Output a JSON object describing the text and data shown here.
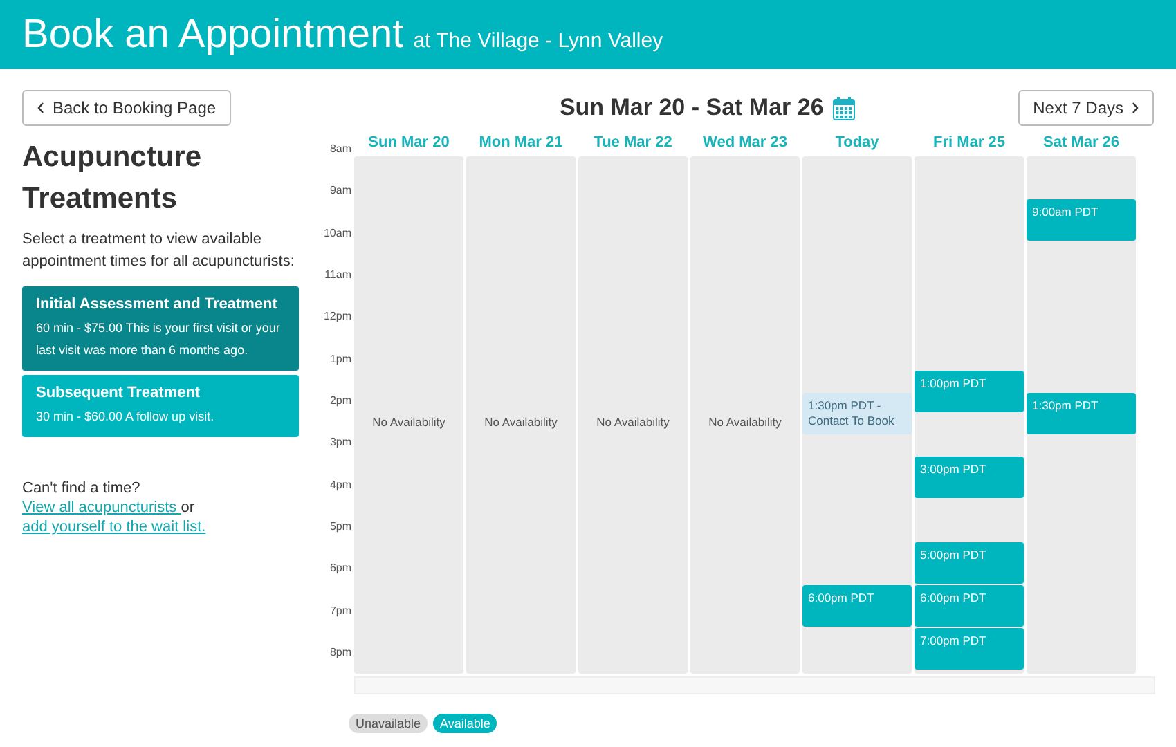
{
  "header": {
    "title": "Book an Appointment",
    "location": "at The Village - Lynn Valley"
  },
  "toolbar": {
    "back_button": "Back to Booking Page",
    "date_range": "Sun Mar 20 - Sat Mar 26",
    "next_button": "Next 7 Days"
  },
  "sidebar": {
    "title": "Acupuncture Treatments",
    "intro": "Select a treatment to view available appointment times for all acupuncturists:",
    "treatments": [
      {
        "name": "Initial Assessment and Treatment",
        "details": "60 min - $75.00 This is your first visit or your last visit was more than 6 months ago.",
        "selected": true
      },
      {
        "name": "Subsequent Treatment",
        "details": "30 min - $60.00 A follow up visit.",
        "selected": false
      }
    ],
    "help_title": "Can't find a time?",
    "help_link_1": "View all acupuncturists ",
    "help_joiner": "or",
    "help_link_2": "add yourself to the wait list."
  },
  "calendar": {
    "hours": [
      "8am",
      "9am",
      "10am",
      "11am",
      "12pm",
      "1pm",
      "2pm",
      "3pm",
      "4pm",
      "5pm",
      "6pm",
      "7pm",
      "8pm"
    ],
    "days": [
      {
        "label": "Sun Mar 20",
        "note": "No Availability"
      },
      {
        "label": "Mon Mar 21",
        "note": "No Availability"
      },
      {
        "label": "Tue Mar 22",
        "note": "No Availability"
      },
      {
        "label": "Wed Mar 23",
        "note": "No Availability"
      },
      {
        "label": "Today",
        "slots": [
          {
            "kind": "contact",
            "text": "1:30pm PDT - Contact To Book"
          },
          {
            "kind": "available",
            "text": "6:00pm PDT"
          }
        ]
      },
      {
        "label": "Fri Mar 25",
        "slots": [
          {
            "kind": "available",
            "text": "1:00pm PDT"
          },
          {
            "kind": "available",
            "text": "3:00pm PDT"
          },
          {
            "kind": "available",
            "text": "5:00pm PDT"
          },
          {
            "kind": "available",
            "text": "6:00pm PDT"
          },
          {
            "kind": "available",
            "text": "7:00pm PDT"
          }
        ]
      },
      {
        "label": "Sat Mar 26",
        "slots": [
          {
            "kind": "available",
            "text": "9:00am PDT"
          },
          {
            "kind": "available",
            "text": "1:30pm PDT"
          }
        ]
      }
    ]
  },
  "legend": [
    {
      "kind": "unavailable",
      "label": "Unavailable"
    },
    {
      "kind": "available",
      "label": "Available"
    }
  ]
}
